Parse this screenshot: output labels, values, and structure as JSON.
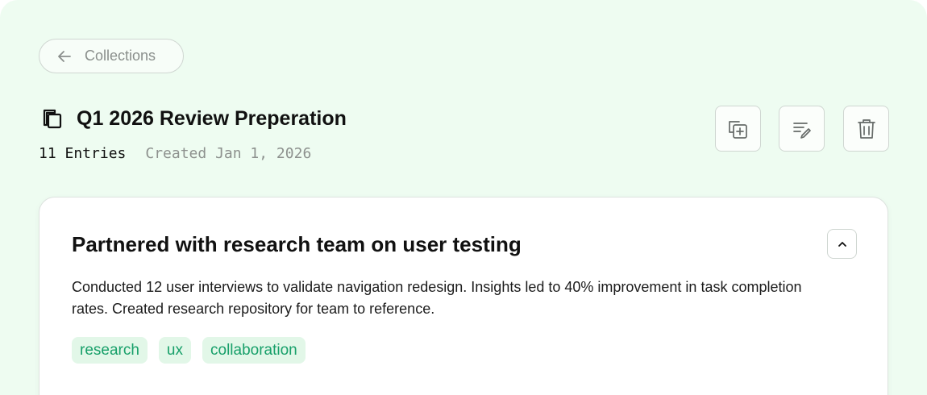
{
  "navigation": {
    "back_label": "Collections",
    "back_icon": "arrow-left-icon"
  },
  "collection": {
    "icon": "collection-copy-icon",
    "title": "Q1 2026 Review Preperation",
    "entry_count": "11 Entries",
    "created": "Created Jan 1, 2026"
  },
  "actions": [
    {
      "name": "add-entry-icon"
    },
    {
      "name": "edit-notes-icon"
    },
    {
      "name": "trash-icon"
    }
  ],
  "entry": {
    "title": "Partnered with research team on user testing",
    "description": "Conducted 12 user interviews to validate navigation redesign. Insights led to 40% improvement in task completion rates. Created research repository for team to reference.",
    "tags": [
      "research",
      "ux",
      "collaboration"
    ],
    "collapse_icon": "chevron-up-icon"
  },
  "colors": {
    "background": "#eefcf1",
    "tag_bg": "#e2f7e8",
    "tag_text": "#18a06a",
    "muted_text": "#8d918e"
  }
}
